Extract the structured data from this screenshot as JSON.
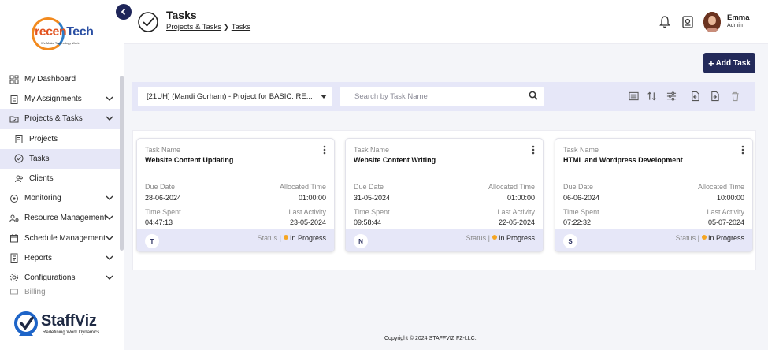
{
  "sidebar": {
    "logo": {
      "brand_a": "recen",
      "brand_b": "Tech",
      "tagline": "We Make Technology Work"
    },
    "items": [
      {
        "label": "My Dashboard",
        "icon": "dashboard-icon"
      },
      {
        "label": "My Assignments",
        "icon": "clipboard-icon"
      },
      {
        "label": "Projects & Tasks",
        "icon": "folder-check-icon"
      },
      {
        "label": "Projects",
        "icon": "projects-icon"
      },
      {
        "label": "Tasks",
        "icon": "check-circle-icon"
      },
      {
        "label": "Clients",
        "icon": "users-icon"
      },
      {
        "label": "Monitoring",
        "icon": "monitor-icon"
      },
      {
        "label": "Resource Management",
        "icon": "people-gear-icon"
      },
      {
        "label": "Schedule Management",
        "icon": "calendar-icon"
      },
      {
        "label": "Reports",
        "icon": "report-icon"
      },
      {
        "label": "Configurations",
        "icon": "gear-icon"
      },
      {
        "label": "Billing",
        "icon": "billing-icon"
      }
    ],
    "footer": {
      "brand": "StaffViz",
      "tagline": "Redefining Work Dynamics"
    }
  },
  "header": {
    "title": "Tasks",
    "breadcrumb": [
      "Projects & Tasks",
      "Tasks"
    ],
    "user": {
      "name": "Emma",
      "role": "Admin"
    }
  },
  "toolbar": {
    "add_task_label": "Add Task",
    "project_select": "[21UH] (Mandi Gorham) - Project for BASIC: RE...",
    "search_placeholder": "Search by Task Name"
  },
  "cards": [
    {
      "task_name_label": "Task Name",
      "task_name": "Website Content Updating",
      "due_label": "Due Date",
      "due": "28-06-2024",
      "alloc_label": "Allocated Time",
      "alloc": "01:00:00",
      "spent_label": "Time Spent",
      "spent": "04:47:13",
      "activity_label": "Last Activity",
      "activity": "23-05-2024",
      "initial": "T",
      "status_label": "Status |",
      "status": "In Progress"
    },
    {
      "task_name_label": "Task Name",
      "task_name": "Website Content Writing",
      "due_label": "Due Date",
      "due": "31-05-2024",
      "alloc_label": "Allocated Time",
      "alloc": "01:00:00",
      "spent_label": "Time Spent",
      "spent": "09:58:44",
      "activity_label": "Last Activity",
      "activity": "22-05-2024",
      "initial": "N",
      "status_label": "Status |",
      "status": "In Progress"
    },
    {
      "task_name_label": "Task Name",
      "task_name": "HTML and Wordpress Development",
      "due_label": "Due Date",
      "due": "06-06-2024",
      "alloc_label": "Allocated Time",
      "alloc": "10:00:00",
      "spent_label": "Time Spent",
      "spent": "07:22:32",
      "activity_label": "Last Activity",
      "activity": "05-07-2024",
      "initial": "S",
      "status_label": "Status |",
      "status": "In Progress"
    }
  ],
  "colors": {
    "primary": "#232a5a",
    "highlight": "#e6e7f8",
    "status_in_progress": "#f5a623"
  },
  "footer": {
    "copyright": "Copyright © 2024 STAFFVIZ FZ-LLC."
  }
}
